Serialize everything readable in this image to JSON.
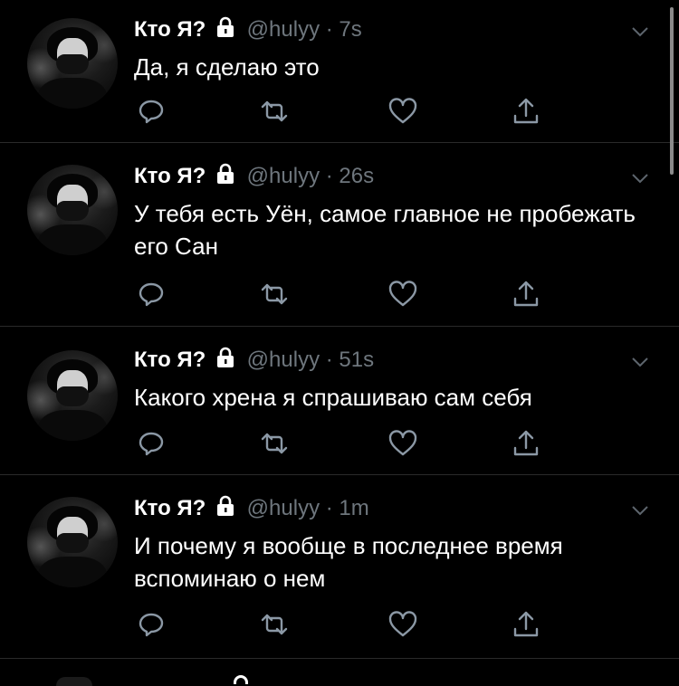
{
  "tweets": [
    {
      "name": "Кто Я?",
      "handle": "@hulyy",
      "sep": "·",
      "time": "7s",
      "text": "Да, я сделаю это"
    },
    {
      "name": "Кто Я?",
      "handle": "@hulyy",
      "sep": "·",
      "time": "26s",
      "text": "У тебя есть Уён, самое главное не пробежать его Сан"
    },
    {
      "name": "Кто Я?",
      "handle": "@hulyy",
      "sep": "·",
      "time": "51s",
      "text": "Какого хрена я спрашиваю сам себя"
    },
    {
      "name": "Кто Я?",
      "handle": "@hulyy",
      "sep": "·",
      "time": "1m",
      "text": "И почему я вообще в последнее время вспоминаю о нем"
    }
  ],
  "icons": {
    "reply": "reply-icon",
    "retweet": "retweet-icon",
    "like": "like-icon",
    "share": "share-icon",
    "lock": "lock-icon",
    "caret": "chevron-down-icon"
  },
  "colors": {
    "background": "#000000",
    "text": "#ffffff",
    "muted": "#6e767d",
    "icon": "#8b98a5",
    "divider": "#2a2a2a"
  }
}
